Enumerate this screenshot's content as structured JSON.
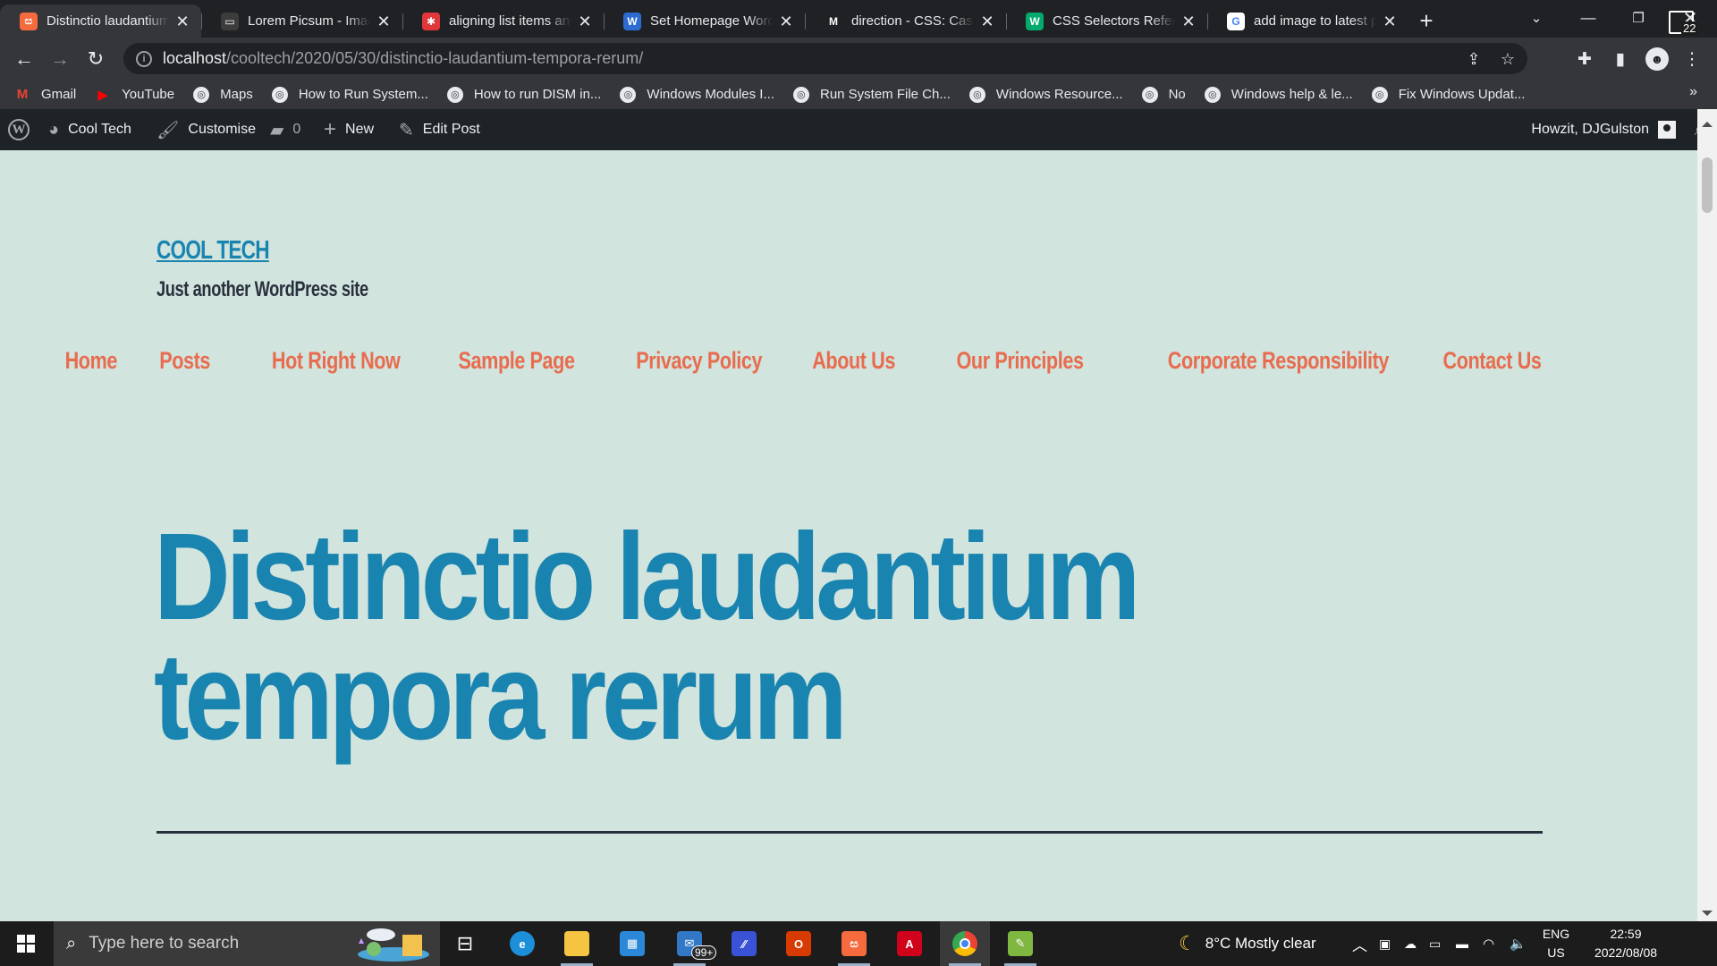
{
  "browser": {
    "tabs": [
      {
        "title": "Distinctio laudantium",
        "favicon_text": "ස",
        "favicon_color": "#f56b3d",
        "active": true
      },
      {
        "title": "Lorem Picsum - Images",
        "favicon_text": "▭",
        "favicon_color": "#3c3c3c",
        "active": false
      },
      {
        "title": "aligning list items and",
        "favicon_text": "✱",
        "favicon_color": "#e0373a",
        "active": false
      },
      {
        "title": "Set Homepage WordPress",
        "favicon_text": "W",
        "favicon_color": "#2e6bd1",
        "active": false
      },
      {
        "title": "direction - CSS: Cascading",
        "favicon_text": "M",
        "favicon_color": "#202124",
        "active": false
      },
      {
        "title": "CSS Selectors Reference",
        "favicon_text": "W",
        "favicon_color": "#04aa6d",
        "active": false
      },
      {
        "title": "add image to latest p",
        "favicon_text": "G",
        "favicon_color": "#ffffff",
        "active": false
      }
    ],
    "url_host": "localhost",
    "url_path": "/cooltech/2020/05/30/distinctio-laudantium-tempora-rerum/",
    "bookmarks": [
      {
        "label": "Gmail",
        "icon": "gmail-icon",
        "glyph": "M",
        "color": "#ea4335"
      },
      {
        "label": "YouTube",
        "icon": "youtube-icon",
        "glyph": "▶",
        "color": "#ff0000"
      },
      {
        "label": "Maps",
        "icon": "globe-icon",
        "glyph": "◎",
        "color": "#e8eaed"
      },
      {
        "label": "How to Run System...",
        "icon": "globe-icon",
        "glyph": "◎",
        "color": "#e8eaed"
      },
      {
        "label": "How to run DISM in...",
        "icon": "globe-icon",
        "glyph": "◎",
        "color": "#e8eaed"
      },
      {
        "label": "Windows Modules I...",
        "icon": "globe-icon",
        "glyph": "◎",
        "color": "#e8eaed"
      },
      {
        "label": "Run System File Ch...",
        "icon": "globe-icon",
        "glyph": "◎",
        "color": "#e8eaed"
      },
      {
        "label": "Windows Resource...",
        "icon": "globe-icon",
        "glyph": "◎",
        "color": "#e8eaed"
      },
      {
        "label": "No",
        "icon": "globe-icon",
        "glyph": "◎",
        "color": "#e8eaed"
      },
      {
        "label": "Windows help & le...",
        "icon": "globe-icon",
        "glyph": "◎",
        "color": "#e8eaed"
      },
      {
        "label": "Fix Windows Updat...",
        "icon": "globe-icon",
        "glyph": "◎",
        "color": "#e8eaed"
      }
    ],
    "bookmarks_more": "»"
  },
  "adminbar": {
    "site_name": "Cool Tech",
    "customise": "Customise",
    "comments_count": "0",
    "new_label": "New",
    "edit_post": "Edit Post",
    "greeting": "Howzit, DJGulston"
  },
  "site": {
    "title": "COOL TECH",
    "description": "Just another WordPress site",
    "menu": [
      "Home",
      "Posts",
      "Hot Right Now",
      "Sample Page",
      "Privacy Policy",
      "About Us",
      "Our Principles",
      "Corporate Responsibility",
      "Contact Us"
    ],
    "post_title": "Distinctio laudantium tempora rerum",
    "colors": {
      "background": "#d1e4dd",
      "title": "#1a84b0",
      "menu": "#e86c4f",
      "text": "#28303d"
    }
  },
  "taskbar": {
    "search_placeholder": "Type here to search",
    "mail_badge": "99+",
    "weather": "8°C  Mostly clear",
    "lang_top": "ENG",
    "lang_bottom": "US",
    "time": "22:59",
    "date": "2022/08/08",
    "notifications": "22"
  }
}
